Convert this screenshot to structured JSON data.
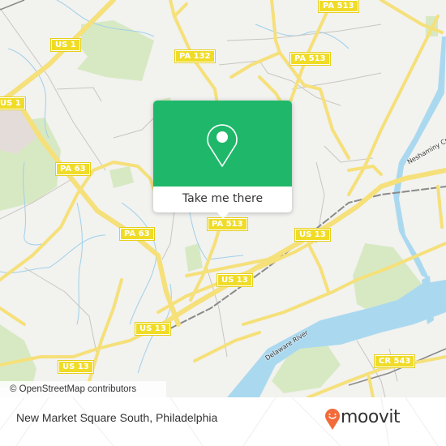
{
  "map": {
    "road_labels": [
      {
        "id": "us1-top",
        "text": "US 1"
      },
      {
        "id": "us1-left",
        "text": "US 1"
      },
      {
        "id": "pa132",
        "text": "PA 132"
      },
      {
        "id": "pa513-top",
        "text": "PA 513"
      },
      {
        "id": "pa513-mid",
        "text": "PA 513"
      },
      {
        "id": "pa513-center",
        "text": "PA 513"
      },
      {
        "id": "pa63-left",
        "text": "PA 63"
      },
      {
        "id": "pa63-center",
        "text": "PA 63"
      },
      {
        "id": "us13-east",
        "text": "US 13"
      },
      {
        "id": "us13-center",
        "text": "US 13"
      },
      {
        "id": "us13-southcenter",
        "text": "US 13"
      },
      {
        "id": "us13-southwest",
        "text": "US 13"
      },
      {
        "id": "cr543",
        "text": "CR 543"
      }
    ],
    "water_labels": {
      "delaware": "Delaware River",
      "neshaminy": "Neshaminy Cr"
    },
    "attribution": "© OpenStreetMap contributors"
  },
  "popup": {
    "icon": "location-pin-icon",
    "button_label": "Take me there",
    "color": "#1fb86a"
  },
  "footer": {
    "place_name": "New Market Square South, Philadelphia",
    "brand": "moovit",
    "brand_color": "#f26b3a"
  }
}
